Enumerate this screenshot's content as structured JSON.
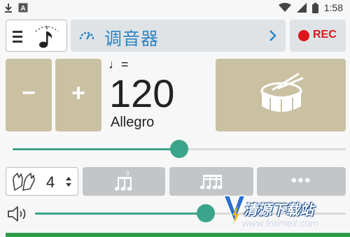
{
  "status": {
    "time": "1:58",
    "icons": [
      "download-icon",
      "font-icon",
      "wifi-icon",
      "signal-icon",
      "battery-icon"
    ]
  },
  "header": {
    "menu_icon": "menu-icon",
    "logo_icon": "metronome-note-icon",
    "gauge_icon": "gauge-icon",
    "title": "调音器",
    "chevron_icon": "chevron-right-icon",
    "rec_label": "REC"
  },
  "tempo": {
    "minus_label": "−",
    "plus_label": "+",
    "note_equals": "♩=",
    "bpm": "120",
    "name": "Allegro",
    "slider_fraction": 0.5
  },
  "beats": {
    "hand_icon": "clap-hands-icon",
    "count": "4",
    "triplet_icon": "triplet-notes-icon",
    "sixteenth_icon": "sixteenth-notes-icon",
    "more_label": "•••"
  },
  "volume": {
    "speaker_icon": "speaker-icon",
    "level_fraction": 0.55
  },
  "watermark": {
    "title": "清源下载站",
    "url": "www.fotimeit.com"
  },
  "colors": {
    "accent": "#3aa58a",
    "tan": "#c9c1a2",
    "rec": "#e0141b",
    "title_blue": "#2f86c4"
  }
}
